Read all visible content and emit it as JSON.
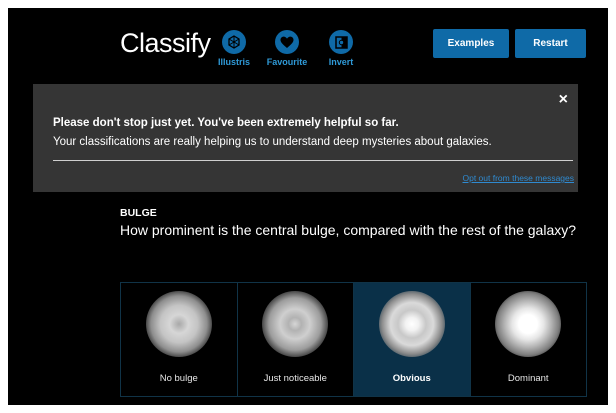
{
  "header": {
    "title": "Classify",
    "tools": [
      {
        "label": "Illustris",
        "icon": "illustris-icon"
      },
      {
        "label": "Favourite",
        "icon": "heart-icon"
      },
      {
        "label": "Invert",
        "icon": "invert-icon"
      }
    ],
    "examples_label": "Examples",
    "restart_label": "Restart"
  },
  "banner": {
    "line1": "Please don't stop just yet. You've been extremely helpful so far.",
    "line2": "Your classifications are really helping us to understand deep mysteries about galaxies.",
    "close": "×",
    "optout": "Opt out from these messages"
  },
  "question": {
    "tag": "BULGE",
    "text": "How prominent is the central bulge, compared with the rest of the galaxy?"
  },
  "answers": [
    {
      "label": "No bulge",
      "selected": false
    },
    {
      "label": "Just noticeable",
      "selected": false
    },
    {
      "label": "Obvious",
      "selected": true
    },
    {
      "label": "Dominant",
      "selected": false
    }
  ],
  "colors": {
    "accent": "#0f6aa7",
    "link": "#2f8ad0",
    "banner_bg": "#353535",
    "selected_bg": "#0a3048"
  }
}
